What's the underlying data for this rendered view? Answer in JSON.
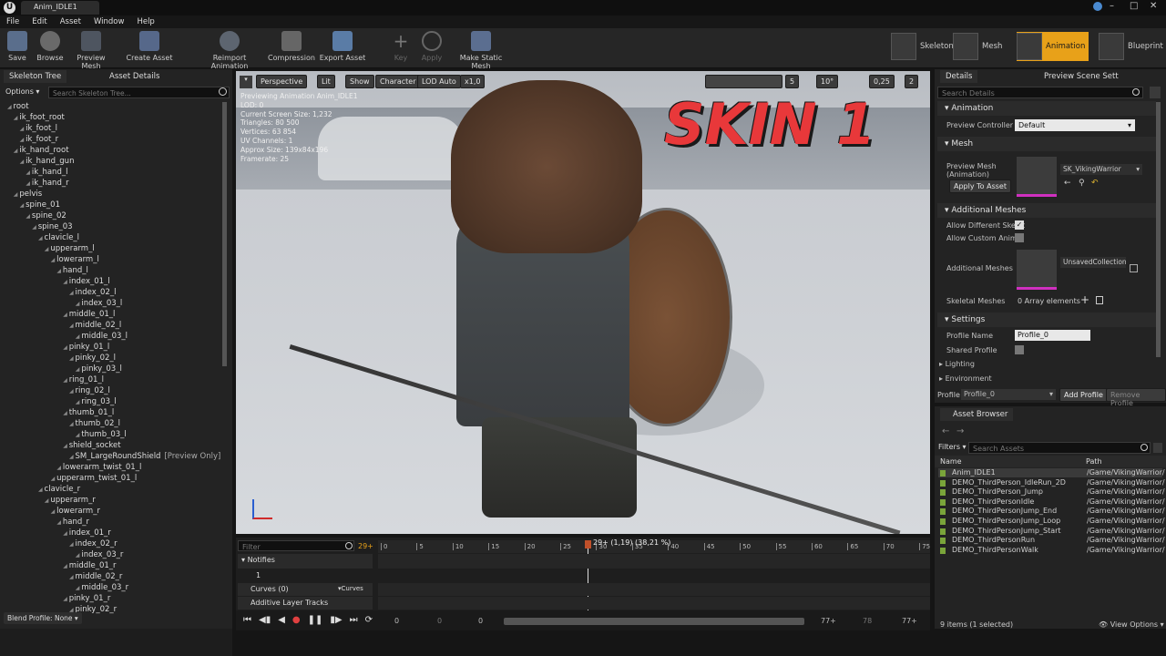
{
  "window": {
    "tab_title": "Anim_IDLE1"
  },
  "menu": [
    "File",
    "Edit",
    "Asset",
    "Window",
    "Help"
  ],
  "toolbar": [
    {
      "label": "Save",
      "icon": "save-icon"
    },
    {
      "label": "Browse",
      "icon": "browse-icon"
    },
    {
      "label": "Preview Mesh",
      "icon": "preview-mesh-icon"
    },
    {
      "label": "Create Asset",
      "icon": "create-asset-icon"
    },
    {
      "label": "Reimport Animation",
      "icon": "reimport-icon"
    },
    {
      "label": "Compression",
      "icon": "compression-icon"
    },
    {
      "label": "Export Asset",
      "icon": "export-icon"
    },
    {
      "label": "Key",
      "icon": "key-icon"
    },
    {
      "label": "Apply",
      "icon": "apply-icon"
    },
    {
      "label": "Make Static Mesh",
      "icon": "static-mesh-icon"
    }
  ],
  "modes": [
    {
      "label": "Skeleton"
    },
    {
      "label": "Mesh"
    },
    {
      "label": "Animation"
    },
    {
      "label": "Blueprint"
    }
  ],
  "left": {
    "tabs": [
      "Skeleton Tree",
      "Asset Details"
    ],
    "options": "Options",
    "search_placeholder": "Search Skeleton Tree...",
    "blend_profile": "Blend Profile: None",
    "bones": [
      "root",
      "ik_foot_root",
      "ik_foot_l",
      "ik_foot_r",
      "ik_hand_root",
      "ik_hand_gun",
      "ik_hand_l",
      "ik_hand_r",
      "pelvis",
      "spine_01",
      "spine_02",
      "spine_03",
      "clavicle_l",
      "upperarm_l",
      "lowerarm_l",
      "hand_l",
      "index_01_l",
      "index_02_l",
      "index_03_l",
      "middle_01_l",
      "middle_02_l",
      "middle_03_l",
      "pinky_01_l",
      "pinky_02_l",
      "pinky_03_l",
      "ring_01_l",
      "ring_02_l",
      "ring_03_l",
      "thumb_01_l",
      "thumb_02_l",
      "thumb_03_l",
      "shield_socket",
      "SM_LargeRoundShield",
      "lowerarm_twist_01_l",
      "upperarm_twist_01_l",
      "clavicle_r",
      "upperarm_r",
      "lowerarm_r",
      "hand_r",
      "index_01_r",
      "index_02_r",
      "index_03_r",
      "middle_01_r",
      "middle_02_r",
      "middle_03_r",
      "pinky_01_r",
      "pinky_02_r"
    ],
    "preview_only": "[Preview Only]"
  },
  "viewport": {
    "buttons": [
      "Perspective",
      "Lit",
      "Show",
      "Character",
      "LOD Auto",
      "x1,0"
    ],
    "right_values": [
      "5",
      "10°",
      "0,25",
      "2"
    ],
    "info": [
      "Previewing Animation Anim_IDLE1",
      "LOD: 0",
      "Current Screen Size: 1,232",
      "Triangles: 80 500",
      "Vertices: 63 854",
      "UV Channels: 1",
      "Approx Size: 139x84x196",
      "Framerate: 25"
    ],
    "overlay": "SKIN 1"
  },
  "timeline": {
    "filter_placeholder": "Filter",
    "frame": "29+",
    "playhead": "29+ (1,19) (38,21 %)",
    "ticks": [
      "0",
      "5",
      "10",
      "15",
      "20",
      "25",
      "30",
      "35",
      "40",
      "45",
      "50",
      "55",
      "60",
      "65",
      "70",
      "75"
    ],
    "notifies": "Notifies",
    "track": "1",
    "curves": "Curves",
    "curves_count": "(0)",
    "curves_btn": "Curves",
    "additive": "Additive Layer Tracks",
    "range": [
      "0",
      "0",
      "0",
      "77+",
      "78",
      "77+"
    ]
  },
  "details": {
    "tabs": [
      "Details",
      "Preview Scene Sett"
    ],
    "search_placeholder": "Search Details",
    "animation": "Animation",
    "preview_controller_label": "Preview Controller",
    "preview_controller": "Default",
    "mesh": "Mesh",
    "preview_mesh_label": "Preview Mesh (Animation)",
    "preview_mesh": "SK_VikingWarrior",
    "apply_to_asset": "Apply To Asset",
    "additional_meshes_section": "Additional Meshes",
    "allow_different": "Allow Different Skelet",
    "allow_custom": "Allow Custom AnimBl",
    "additional_meshes_label": "Additional Meshes",
    "collection": "UnsavedCollection",
    "skeletal_meshes_label": "Skeletal Meshes",
    "skeletal_meshes": "0 Array elements",
    "settings": "Settings",
    "profile_name_label": "Profile Name",
    "profile_name": "Profile_0",
    "shared_profile": "Shared Profile",
    "lighting": "Lighting",
    "environment": "Environment",
    "profile_label": "Profile",
    "profile": "Profile_0",
    "add_profile": "Add Profile",
    "remove_profile": "Remove Profile"
  },
  "asset_browser": {
    "tab": "Asset Browser",
    "filters": "Filters",
    "search_placeholder": "Search Assets",
    "col_name": "Name",
    "col_path": "Path",
    "rows": [
      {
        "name": "Anim_IDLE1",
        "path": "/Game/VikingWarrior/"
      },
      {
        "name": "DEMO_ThirdPerson_IdleRun_2D",
        "path": "/Game/VikingWarrior/"
      },
      {
        "name": "DEMO_ThirdPerson_Jump",
        "path": "/Game/VikingWarrior/"
      },
      {
        "name": "DEMO_ThirdPersonIdle",
        "path": "/Game/VikingWarrior/"
      },
      {
        "name": "DEMO_ThirdPersonJump_End",
        "path": "/Game/VikingWarrior/"
      },
      {
        "name": "DEMO_ThirdPersonJump_Loop",
        "path": "/Game/VikingWarrior/"
      },
      {
        "name": "DEMO_ThirdPersonJump_Start",
        "path": "/Game/VikingWarrior/"
      },
      {
        "name": "DEMO_ThirdPersonRun",
        "path": "/Game/VikingWarrior/"
      },
      {
        "name": "DEMO_ThirdPersonWalk",
        "path": "/Game/VikingWarrior/"
      }
    ],
    "status": "9 items (1 selected)",
    "view_options": "View Options"
  },
  "colors": {
    "accent": "#e8a119",
    "selected": "#3c5a78",
    "overlay_red": "#e8383a"
  }
}
